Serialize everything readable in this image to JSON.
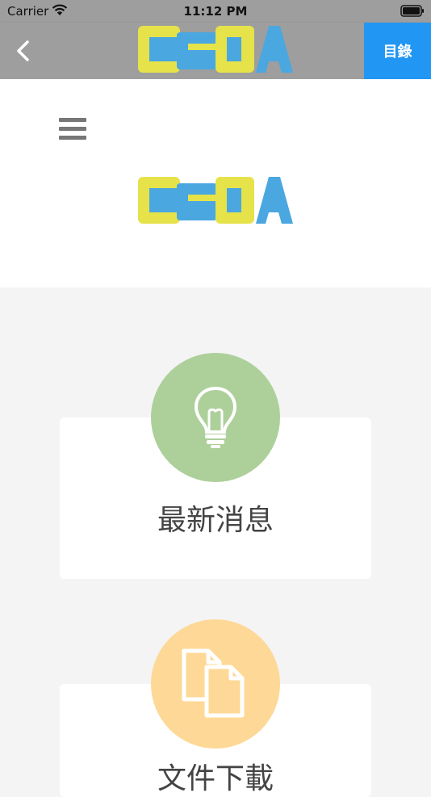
{
  "status_bar": {
    "carrier": "Carrier",
    "time": "11:12 PM"
  },
  "nav": {
    "menu_label": "目錄",
    "logo_text": "CSDA"
  },
  "colors": {
    "bar_gray": "#9e9e9e",
    "menu_blue": "#2196f3",
    "news_green": "#add09b",
    "docs_orange": "#fed896",
    "logo_yellow": "#e6e24a",
    "logo_blue": "#4aa7e0"
  },
  "cards": [
    {
      "label": "最新消息",
      "icon": "lightbulb-icon"
    },
    {
      "label": "文件下載",
      "icon": "documents-icon"
    }
  ]
}
